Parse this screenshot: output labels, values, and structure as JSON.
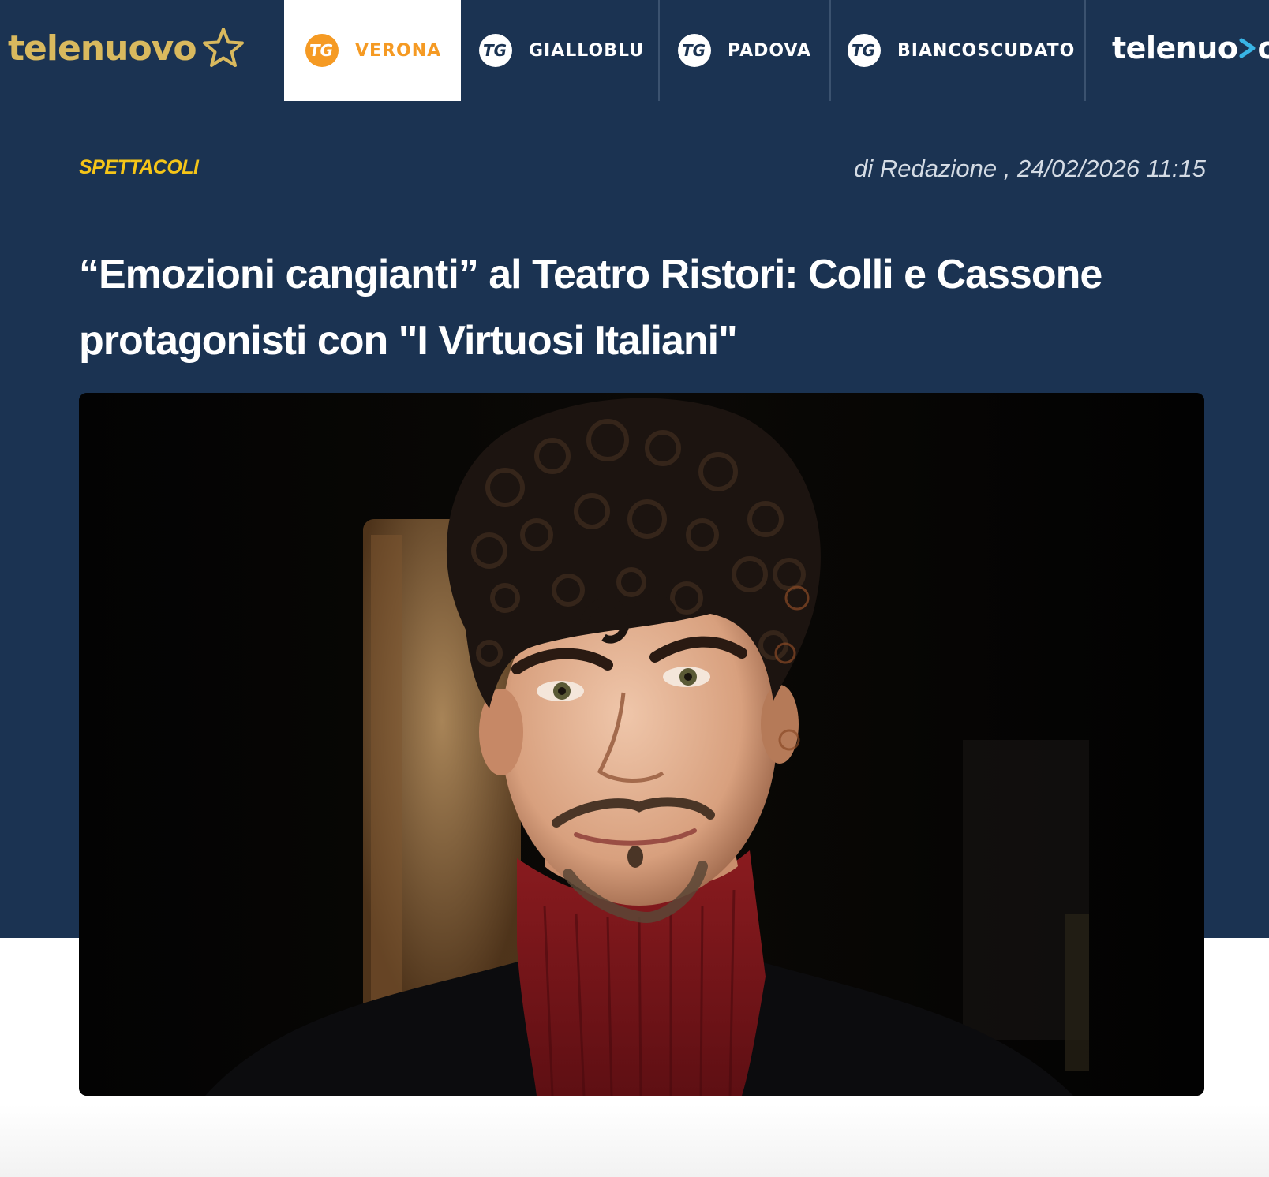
{
  "header": {
    "logo_text": "telenuovo",
    "logo_icon": "star-outline-icon",
    "tabs": [
      {
        "label": "VERONA",
        "icon": "tg-badge-icon",
        "active": true,
        "badge_color": "#f59a23"
      },
      {
        "label": "GIALLOBLU",
        "icon": "tg-badge-icon",
        "active": false,
        "badge_color": "#ffffff"
      },
      {
        "label": "PADOVA",
        "icon": "tg-badge-icon",
        "active": false,
        "badge_color": "#ffffff"
      },
      {
        "label": "BIANCOSCUDATO",
        "icon": "tg-badge-icon",
        "active": false,
        "badge_color": "#ffffff"
      }
    ],
    "badge_text": "TG",
    "brand_right": {
      "left": "telenuo",
      "right": "o",
      "chevron_icon": "chevron-right-icon",
      "chevron_color": "#39b5e6"
    }
  },
  "article": {
    "category": "SPETTACOLI",
    "byline": "di Redazione , 24/02/2026 11:15",
    "title": "“Emozioni cangianti” al Teatro Ristori: Colli e Cassone protagonisti con \"I Virtuosi Italiani\"",
    "image_subject": "portrait-photo"
  },
  "colors": {
    "navy": "#1b3352",
    "accent_orange": "#f59a23",
    "category_yellow": "#f5c518",
    "logo_gold": "#d9b95e"
  }
}
